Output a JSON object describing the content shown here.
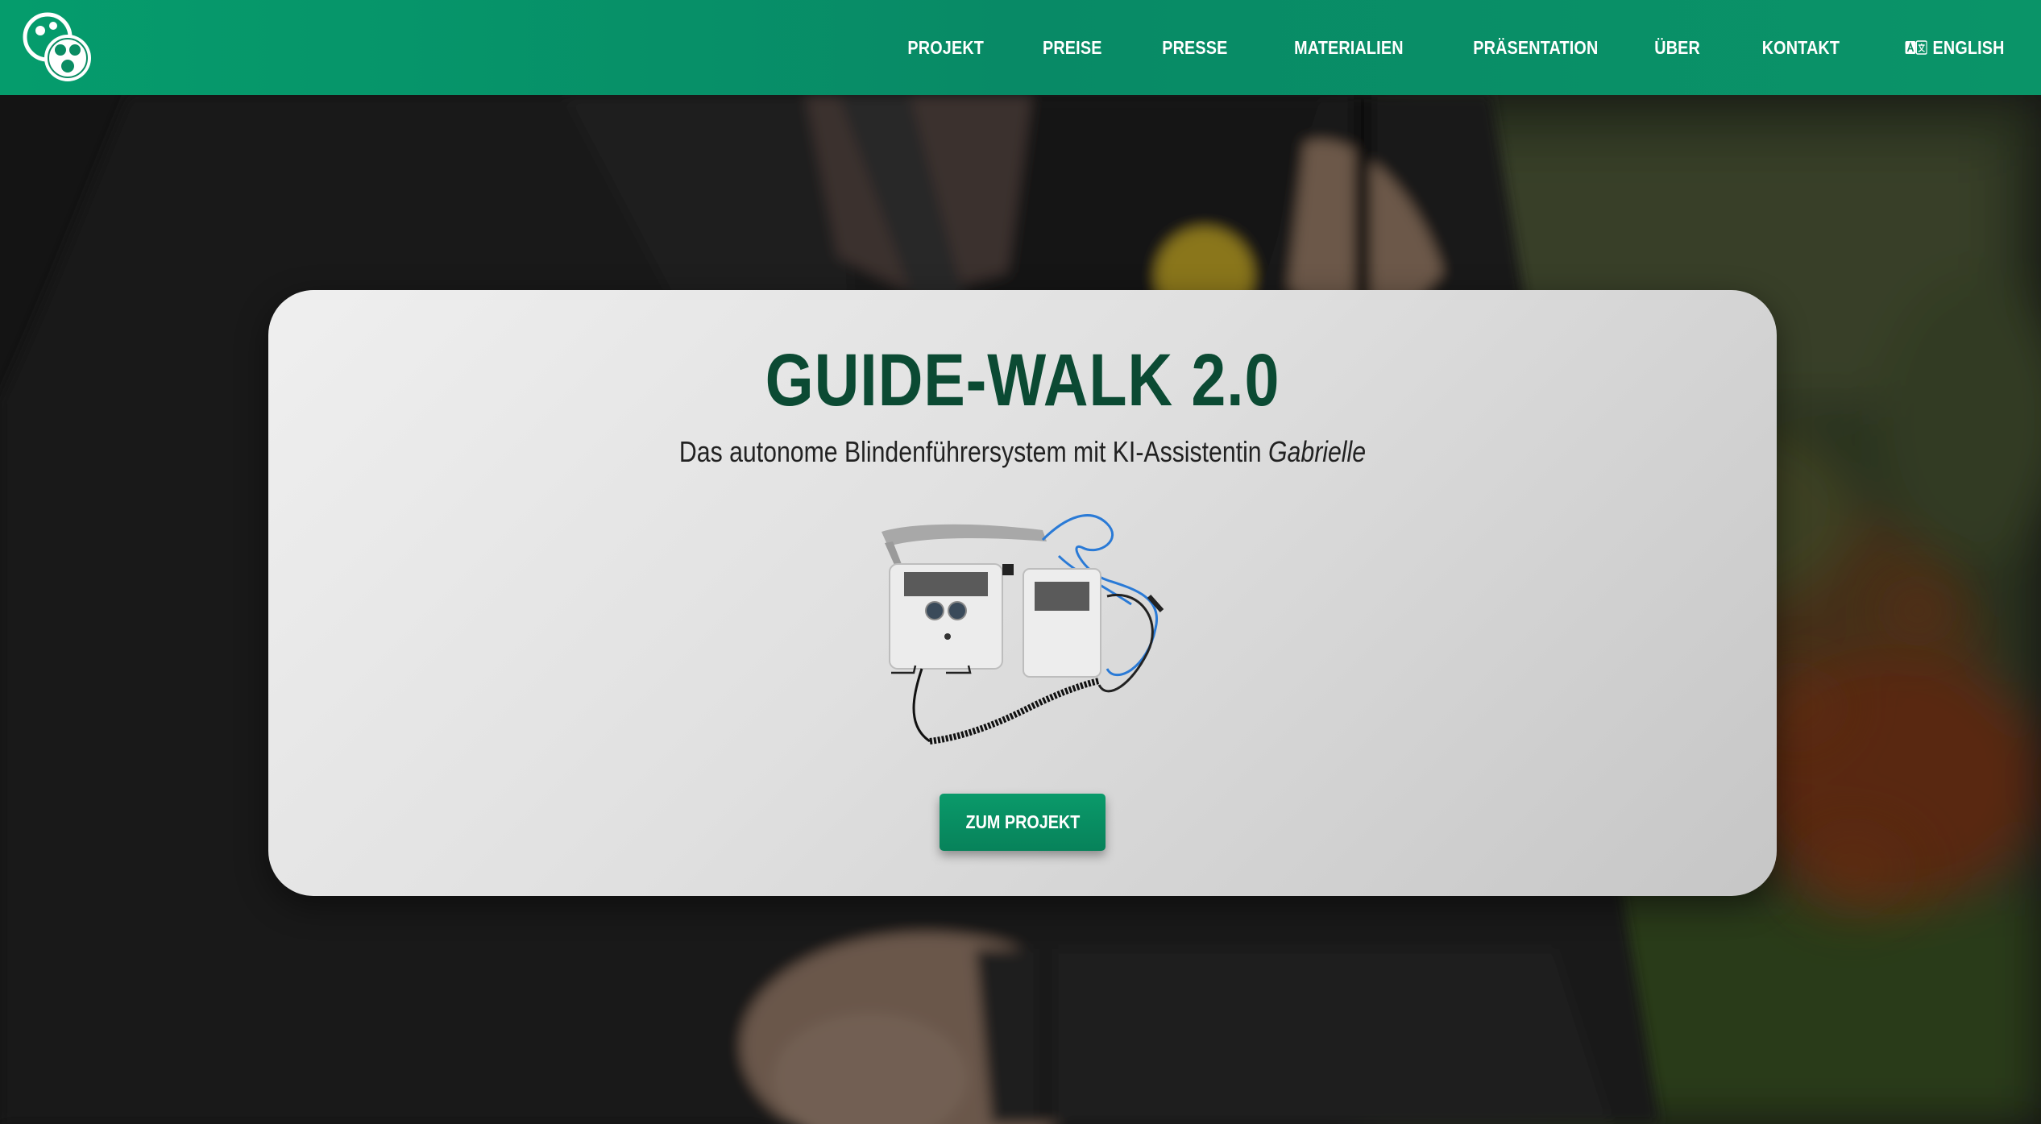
{
  "nav": {
    "items": [
      {
        "label": "PROJEKT"
      },
      {
        "label": "PREISE"
      },
      {
        "label": "PRESSE"
      },
      {
        "label": "MATERIALIEN"
      },
      {
        "label": "PRÄSENTATION"
      },
      {
        "label": "ÜBER"
      },
      {
        "label": "KONTAKT"
      }
    ],
    "language_label": "ENGLISH",
    "language_icon": "translate-icon",
    "logo_icon": "guide-walk-logo"
  },
  "hero": {
    "title": "GUIDE-WALK 2.0",
    "subtitle_main": "Das autonome Blindenführersystem mit KI-Assistentin ",
    "subtitle_name": "Gabrielle",
    "button_label": "ZUM PROJEKT",
    "background_image": "person-with-white-cane-photo",
    "product_image": "guide-walk-device-photo"
  },
  "colors": {
    "brand_green": "#078c63",
    "title_green": "#0b4a33",
    "card_bg": "#e4e4e4"
  }
}
